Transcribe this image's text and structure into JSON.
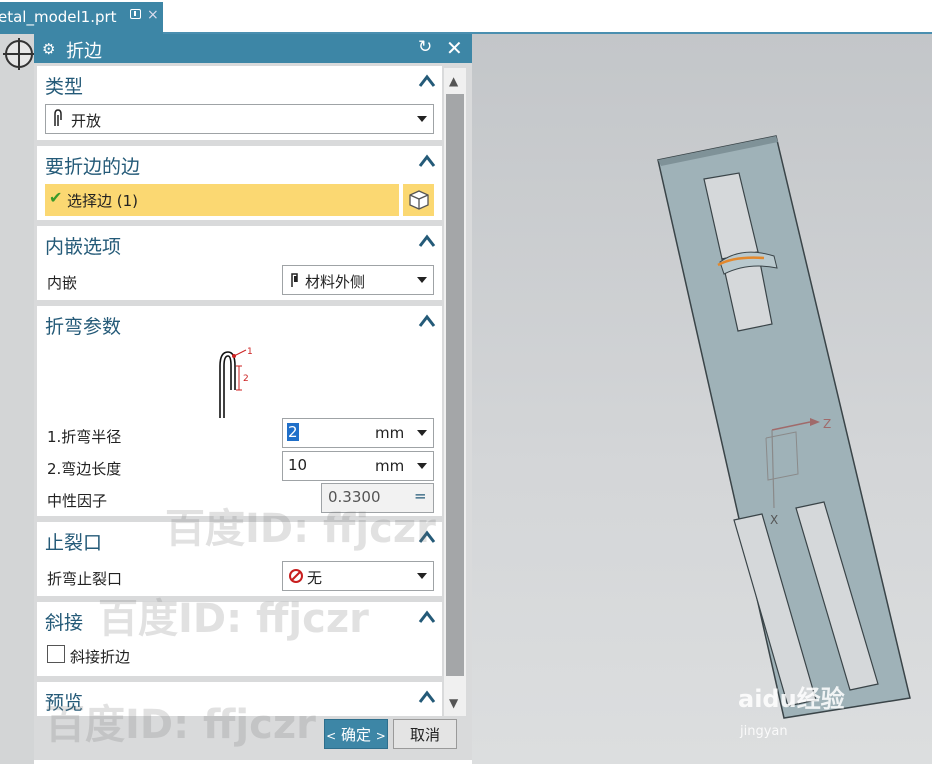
{
  "tab": {
    "title": "etal_model1.prt",
    "close_glyph": "×"
  },
  "dialog": {
    "title": "折边",
    "reset_glyph": "↻",
    "close_glyph": "✕",
    "sections": {
      "type": {
        "heading": "类型",
        "value": "开放"
      },
      "edge": {
        "heading": "要折边的边",
        "select_label": "选择边 (1)"
      },
      "inset": {
        "heading": "内嵌选项",
        "label": "内嵌",
        "value": "材料外侧"
      },
      "bend": {
        "heading": "折弯参数",
        "diagram_marks": [
          "1",
          "2"
        ],
        "radius_label": "1.折弯半径",
        "radius_value": "2",
        "radius_unit": "mm",
        "length_label": "2.弯边长度",
        "length_value": "10",
        "length_unit": "mm",
        "neutral_label": "中性因子",
        "neutral_value": "0.3300",
        "neutral_op": "="
      },
      "relief": {
        "heading": "止裂口",
        "label": "折弯止裂口",
        "value": "无"
      },
      "miter": {
        "heading": "斜接",
        "checkbox_label": "斜接折边"
      },
      "preview": {
        "heading": "预览"
      }
    },
    "buttons": {
      "ok": "确定",
      "cancel": "取消"
    }
  },
  "viewport": {
    "axis_x": "X",
    "axis_z": "Z",
    "logo_text": "aidu经验",
    "logo_sub": "jingyan"
  },
  "watermarks": [
    "百度ID: ffjczr",
    "百度ID: ffjczr",
    "百度ID: ffjczr"
  ],
  "colors": {
    "accent": "#3d86a6",
    "header_text": "#245a78",
    "selected_row": "#fbd872",
    "ok_button": "#3d86a6"
  }
}
